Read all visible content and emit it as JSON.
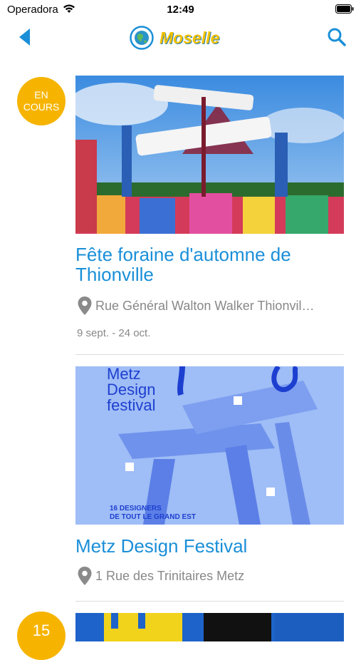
{
  "status_bar": {
    "carrier": "Operadora",
    "time": "12:49"
  },
  "header": {
    "title": "Moselle",
    "back_icon": "chevron-left-icon",
    "search_icon": "search-icon"
  },
  "events": [
    {
      "badge": {
        "line1": "EN",
        "line2": "COURS"
      },
      "title": "Fête foraine d'automne de Thionville",
      "location": "Rue Général Walton Walker Thionvil…",
      "dates": "9 sept. - 24 oct."
    },
    {
      "poster_text": {
        "line1": "Metz",
        "line2": "Design",
        "line3": "festival",
        "caption1": "16 DESIGNERS",
        "caption2": "DE TOUT LE GRAND EST"
      },
      "title": "Metz Design Festival",
      "location": "1 Rue des Trinitaires Metz"
    },
    {
      "badge": {
        "day": "15"
      }
    }
  ],
  "colors": {
    "accent": "#1a8fd8",
    "badge": "#f6b400",
    "muted": "#888888"
  }
}
